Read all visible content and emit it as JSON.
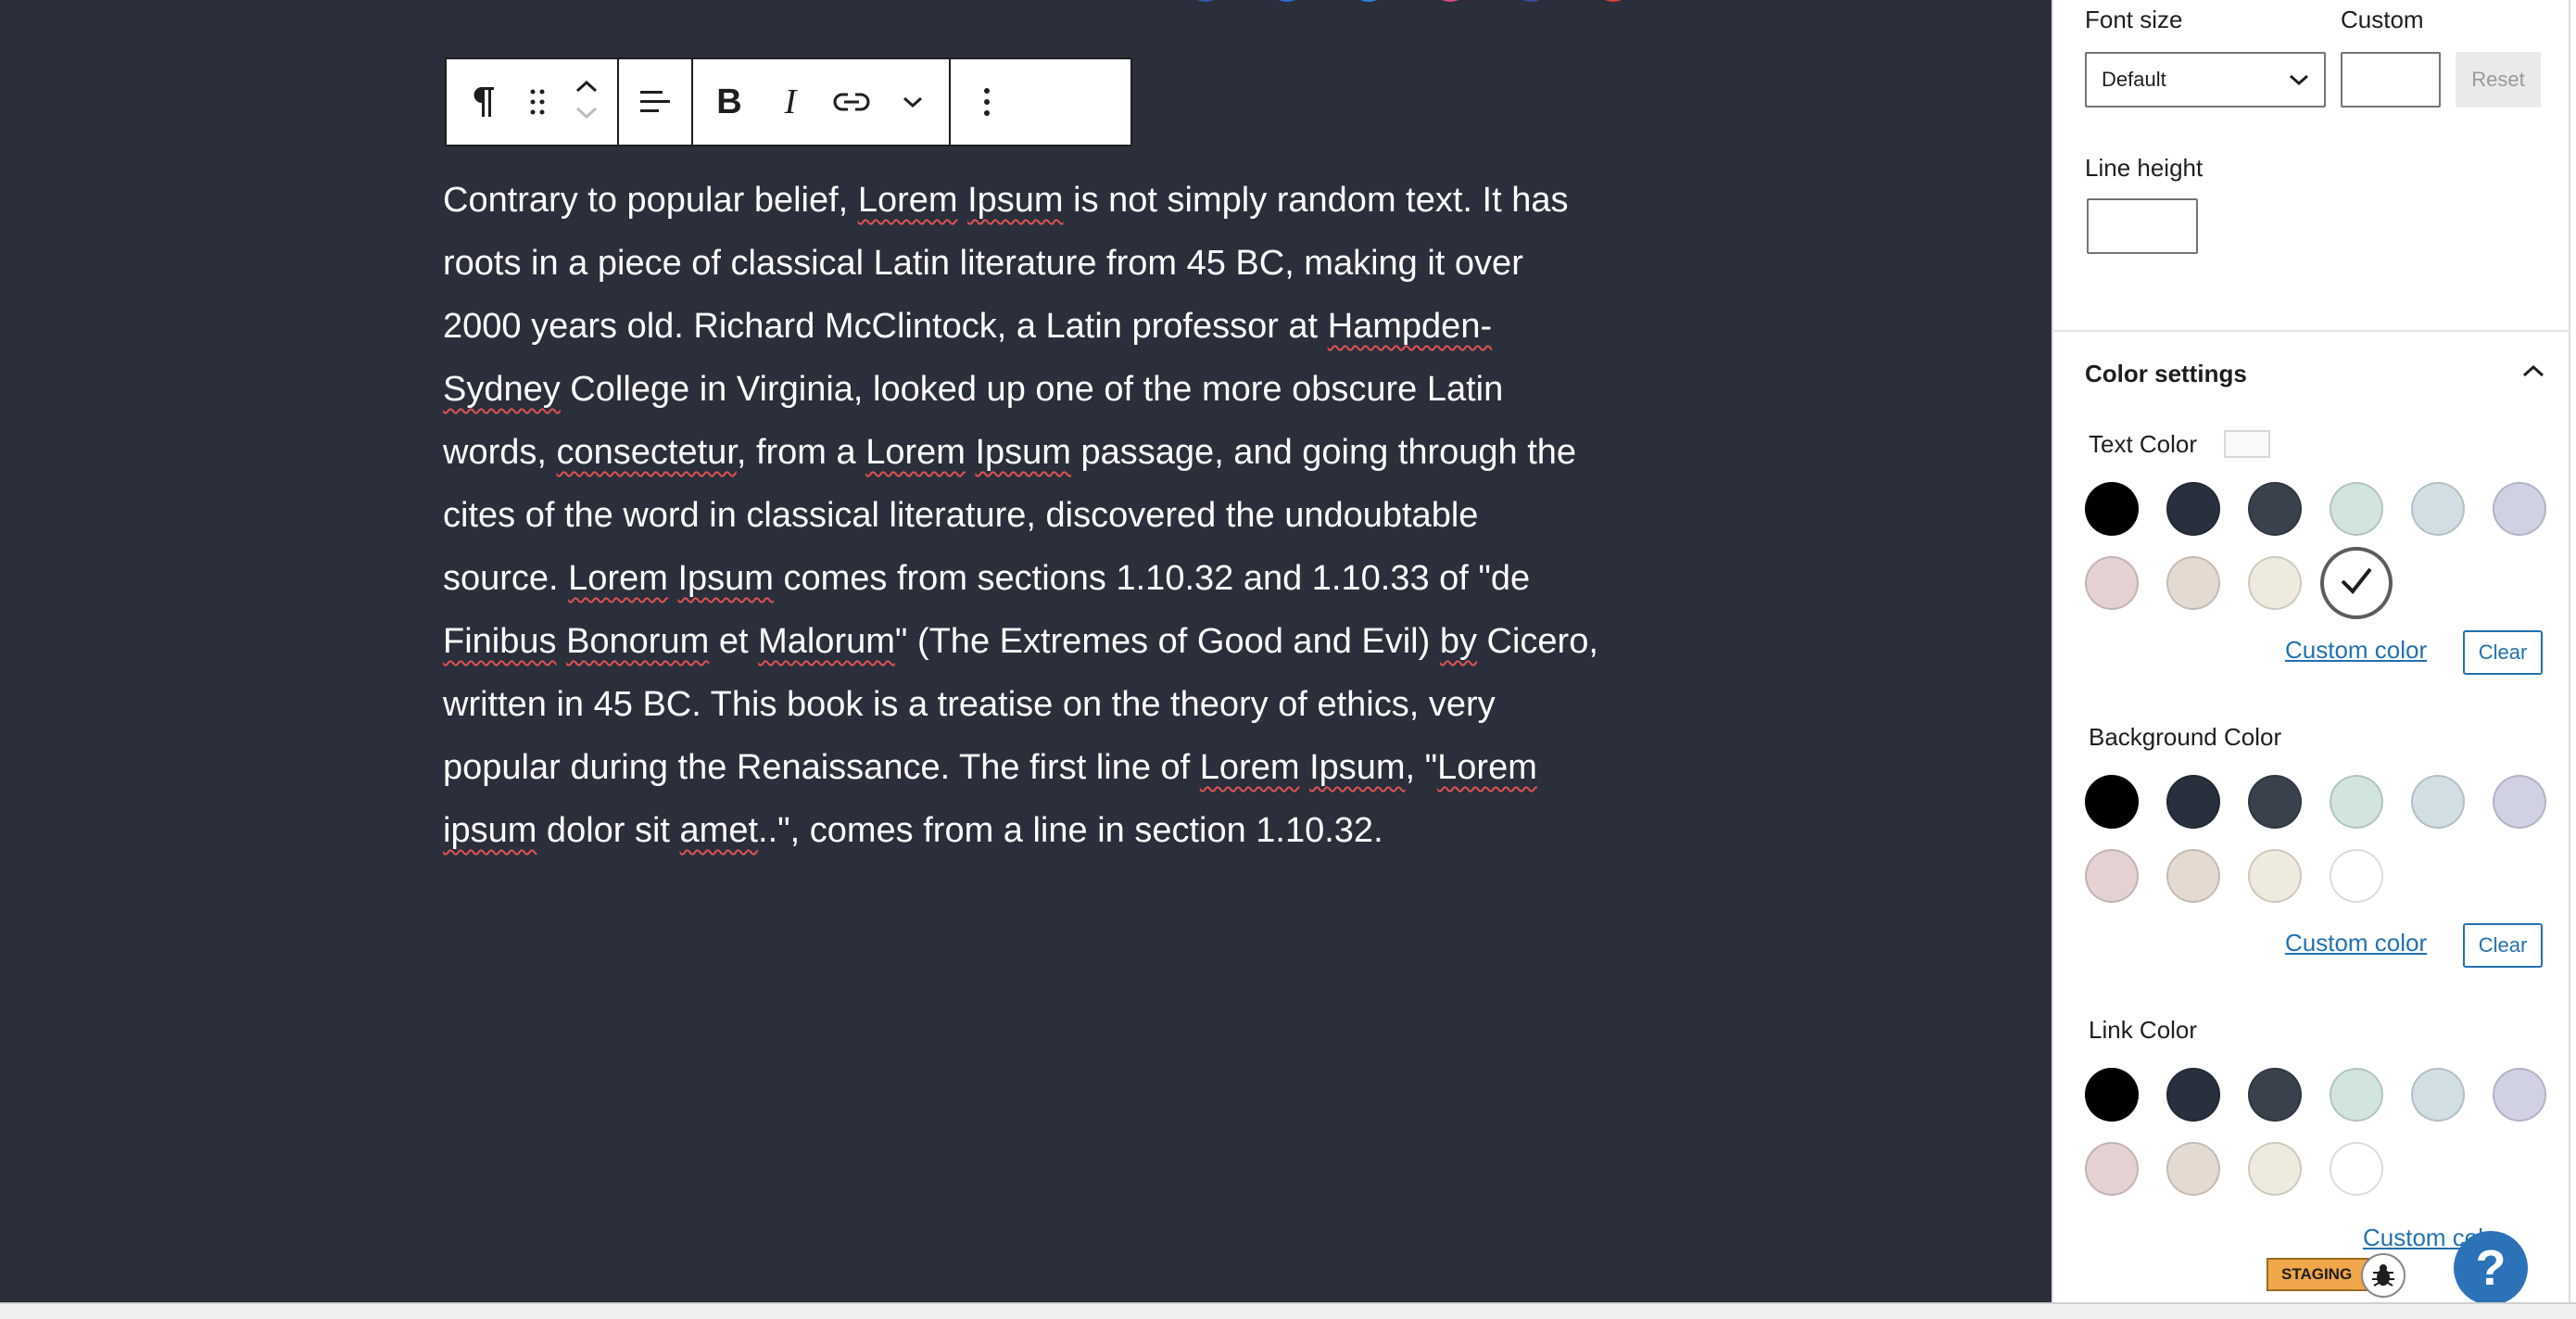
{
  "editor": {
    "paragraph": [
      {
        "t": "Contrary to popular belief, "
      },
      {
        "t": "Lorem",
        "u": true
      },
      {
        "t": " "
      },
      {
        "t": "Ipsum",
        "u": true
      },
      {
        "t": " is not simply random text. It has roots in a piece of classical Latin literature from 45 BC, making it over 2000 years old. Richard McClintock, a Latin professor at "
      },
      {
        "t": "Hampden-Sydney",
        "u": true
      },
      {
        "t": " College in Virginia, looked up one of the more obscure Latin words, "
      },
      {
        "t": "consectetur",
        "u": true
      },
      {
        "t": ", from a "
      },
      {
        "t": "Lorem",
        "u": true
      },
      {
        "t": " "
      },
      {
        "t": "Ipsum",
        "u": true
      },
      {
        "t": " passage, and going through the cites of the word in classical literature, discovered the undoubtable source. "
      },
      {
        "t": "Lorem",
        "u": true
      },
      {
        "t": " "
      },
      {
        "t": "Ipsum",
        "u": true
      },
      {
        "t": " comes from sections 1.10.32 and 1.10.33 of \"de "
      },
      {
        "t": "Finibus",
        "u": true
      },
      {
        "t": " "
      },
      {
        "t": "Bonorum",
        "u": true
      },
      {
        "t": " et "
      },
      {
        "t": "Malorum",
        "u": true
      },
      {
        "t": "\" (The Extremes of Good and Evil) "
      },
      {
        "t": "by",
        "u": true
      },
      {
        "t": " Cicero, written in 45 BC. This book is a treatise on the theory of ethics, very popular during the Renaissance. The first line of "
      },
      {
        "t": "Lorem",
        "u": true
      },
      {
        "t": " "
      },
      {
        "t": "Ipsum",
        "u": true
      },
      {
        "t": ", \""
      },
      {
        "t": "Lorem",
        "u": true
      },
      {
        "t": " "
      },
      {
        "t": "ipsum",
        "u": true
      },
      {
        "t": " dolor sit "
      },
      {
        "t": "amet",
        "u": true
      },
      {
        "t": "..\", comes from a line in section 1.10.32."
      }
    ],
    "top_dot_colors": [
      "#2b5fa8",
      "#2f6fd0",
      "#2a7fe0",
      "#e0457b",
      "#3a4ea0",
      "#e03a3a"
    ]
  },
  "sidebar": {
    "font_size_label": "Font size",
    "custom_label": "Custom",
    "font_size_value": "Default",
    "custom_value": "",
    "reset_label": "Reset",
    "line_height_label": "Line height",
    "line_height_value": "",
    "color_settings_title": "Color settings",
    "text_color_label": "Text Color",
    "background_color_label": "Background Color",
    "link_color_label": "Link Color",
    "custom_color_label": "Custom color",
    "clear_label": "Clear",
    "palette": [
      "#000000",
      "#28303d",
      "#39414d",
      "#d1e4dd",
      "#d1dfe4",
      "#d1d1e4",
      "#e4d1d1",
      "#e4dad1",
      "#eeeadd",
      "#ffffff"
    ],
    "selected_text_color_index": 9
  },
  "staging_label": "STAGING",
  "help_label": "?"
}
